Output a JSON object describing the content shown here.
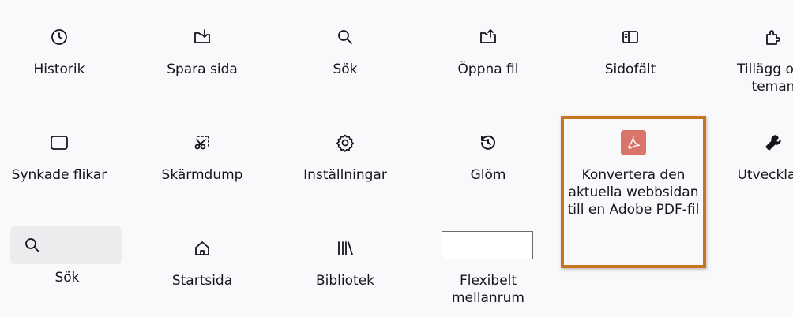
{
  "row1": [
    {
      "label": "Historik",
      "icon": "clock-icon"
    },
    {
      "label": "Spara sida",
      "icon": "save-page-icon"
    },
    {
      "label": "Sök",
      "icon": "search-icon"
    },
    {
      "label": "Öppna fil",
      "icon": "open-file-icon"
    },
    {
      "label": "Sidofält",
      "icon": "sidebar-icon"
    },
    {
      "label": "Tillägg och teman",
      "icon": "puzzle-icon"
    }
  ],
  "row2": [
    {
      "label": "Synkade flikar",
      "icon": "tab-icon"
    },
    {
      "label": "Skärmdump",
      "icon": "screenshot-icon"
    },
    {
      "label": "Inställningar",
      "icon": "gear-icon"
    },
    {
      "label": "Glöm",
      "icon": "forget-icon"
    },
    {
      "label": "Konvertera den aktuella webbsidan till en Adobe PDF-fil",
      "icon": "adobe-pdf-icon"
    },
    {
      "label": "Utvecklare",
      "icon": "wrench-icon"
    }
  ],
  "row3": [
    {
      "label": "Sök",
      "icon": "search-icon"
    },
    {
      "label": "Startsida",
      "icon": "home-icon"
    },
    {
      "label": "Bibliotek",
      "icon": "library-icon"
    },
    {
      "label": "Flexibelt mellanrum",
      "icon": "flexible-space"
    }
  ],
  "colors": {
    "background": "#f9f9fb",
    "highlight_border": "#c8741a",
    "pdf_badge": "#d9746a",
    "search_widget": "#ececef"
  }
}
